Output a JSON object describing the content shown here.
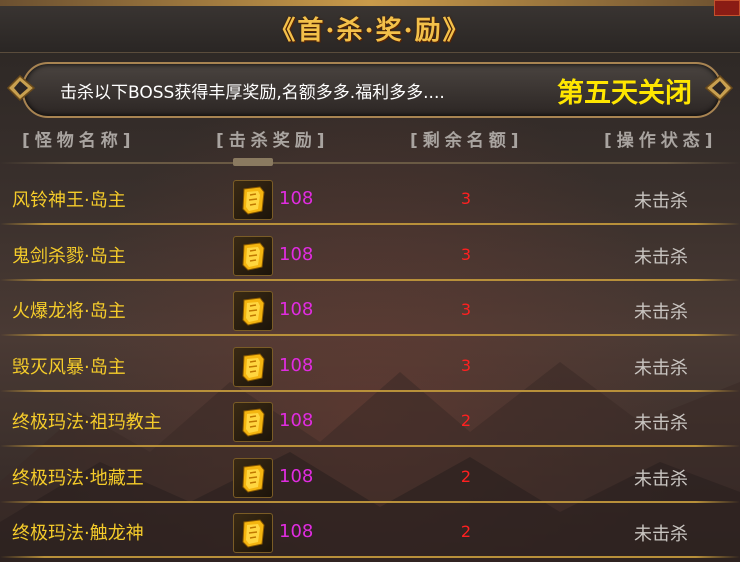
{
  "window": {
    "title": "《首·杀·奖·励》"
  },
  "banner": {
    "text": "击杀以下BOSS获得丰厚奖励,名额多多.福利多多....",
    "closing": "第五天关闭"
  },
  "columns": {
    "monster": "[怪物名称]",
    "reward": "[击杀奖励]",
    "remaining": "[剩余名额]",
    "status": "[操作状态]"
  },
  "rows": [
    {
      "name": "风铃神王·岛主",
      "icon": "gold-ingot-icon",
      "reward": "108",
      "remaining": "3",
      "status": "未击杀"
    },
    {
      "name": "鬼剑杀戮·岛主",
      "icon": "gold-ingot-icon",
      "reward": "108",
      "remaining": "3",
      "status": "未击杀"
    },
    {
      "name": "火爆龙将·岛主",
      "icon": "gold-ingot-icon",
      "reward": "108",
      "remaining": "3",
      "status": "未击杀"
    },
    {
      "name": "毁灭风暴·岛主",
      "icon": "gold-ingot-icon",
      "reward": "108",
      "remaining": "3",
      "status": "未击杀"
    },
    {
      "name": "终极玛法·祖玛教主",
      "icon": "gold-ingot-icon",
      "reward": "108",
      "remaining": "2",
      "status": "未击杀"
    },
    {
      "name": "终极玛法·地藏王",
      "icon": "gold-ingot-icon",
      "reward": "108",
      "remaining": "2",
      "status": "未击杀"
    },
    {
      "name": "终极玛法·触龙神",
      "icon": "gold-ingot-icon",
      "reward": "108",
      "remaining": "2",
      "status": "未击杀"
    }
  ],
  "colors": {
    "title": "#f3c04a",
    "monster_name": "#f5cc2a",
    "reward_amount": "#e02ce0",
    "remaining": "#ff2020",
    "status": "#c8c4c0",
    "banner_highlight": "#ffe600"
  }
}
